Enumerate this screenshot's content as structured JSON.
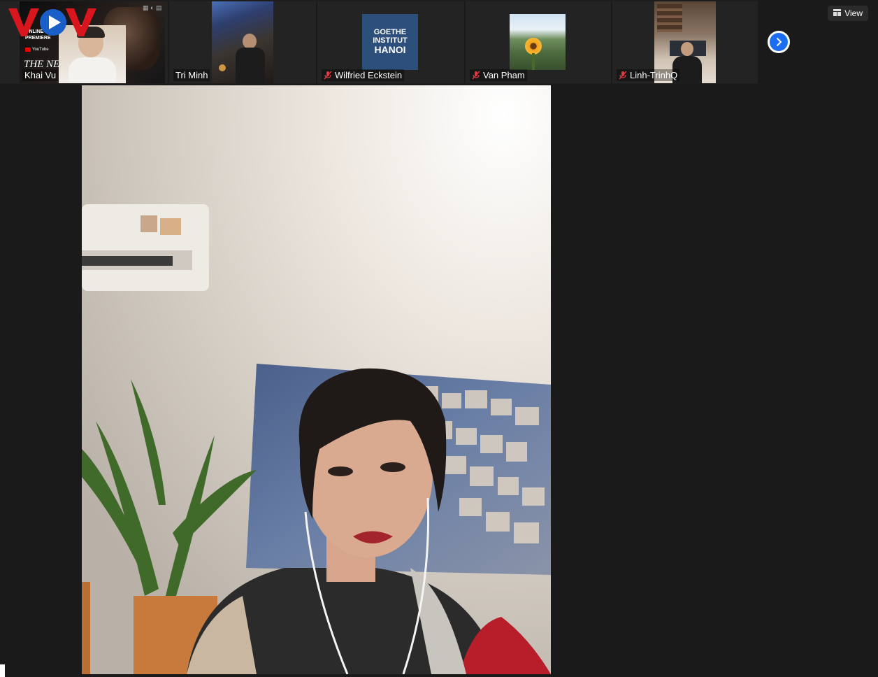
{
  "participants": [
    {
      "name": "Khai Vu",
      "muted": false
    },
    {
      "name": "Tri Minh",
      "muted": false
    },
    {
      "name": "Wilfried Eckstein",
      "muted": true
    },
    {
      "name": "Van Pham",
      "muted": true
    },
    {
      "name": "Linh-TrinhQ",
      "muted": true
    }
  ],
  "view_button": {
    "label": "View"
  },
  "thumbnail_text": {
    "goethe_line1": "GOETHE",
    "goethe_line2": "INSTITUT",
    "goethe_line3": "HANOI",
    "poster_online": "ONLINE",
    "poster_premiere": "PREMIERE",
    "poster_youtube": "YouTube",
    "poster_title": "THE NE"
  },
  "watermark": {
    "text": "VOV",
    "brand_red": "#d9161d",
    "brand_blue": "#1a5fc9"
  },
  "colors": {
    "background": "#1a1a1a",
    "accent_blue": "#1a6cf0",
    "muted_red": "#e0393e"
  }
}
